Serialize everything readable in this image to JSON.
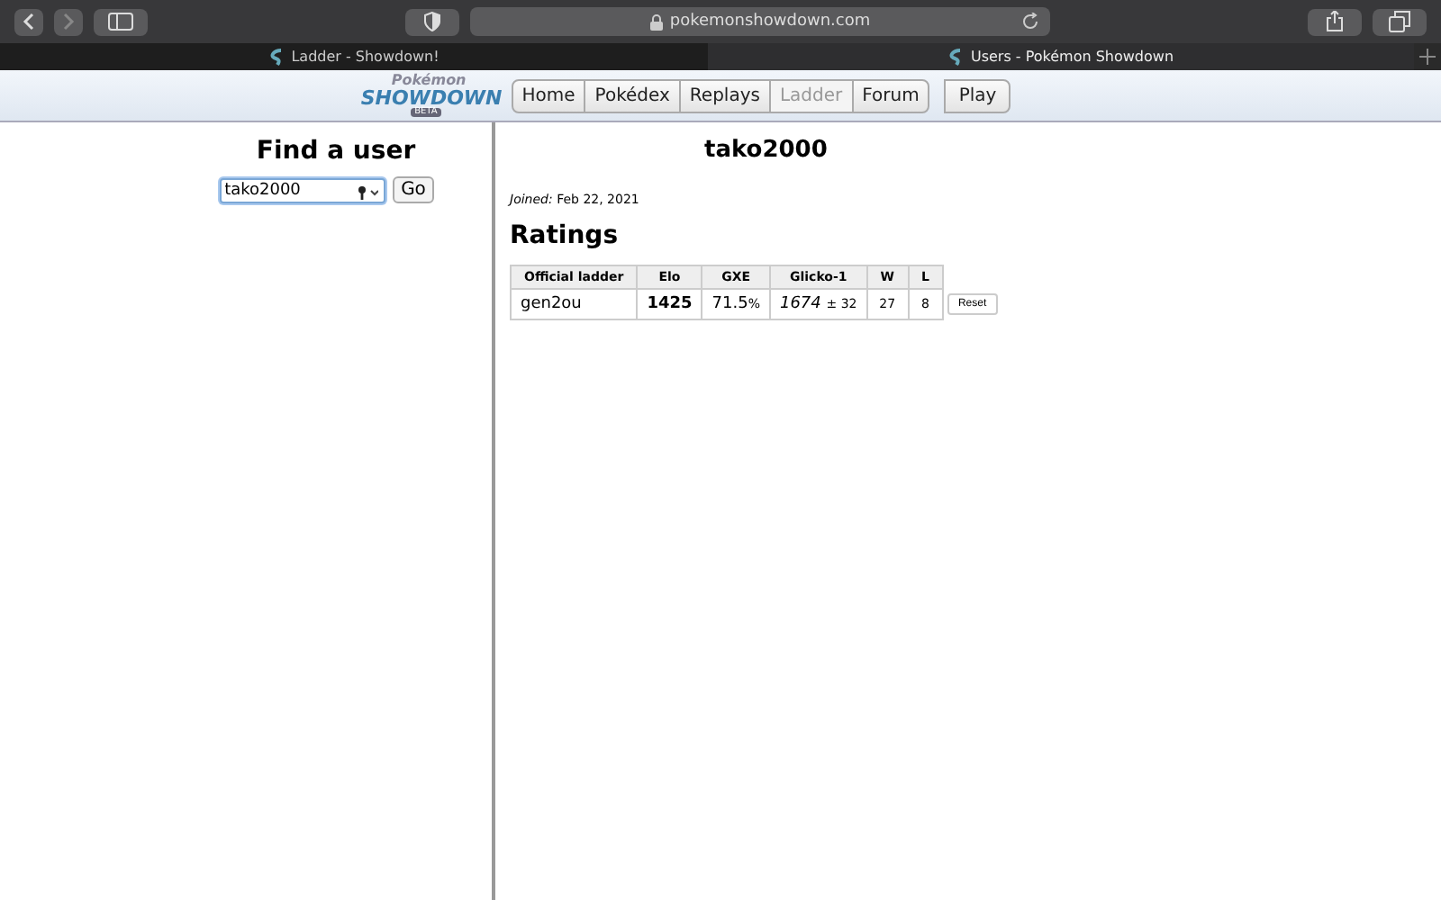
{
  "browser": {
    "url": "pokemonshowdown.com",
    "tabs": [
      {
        "title": "Ladder - Showdown!",
        "selected": false
      },
      {
        "title": "Users - Pokémon Showdown",
        "selected": true
      }
    ]
  },
  "logo": {
    "top": "Pokémon",
    "main": "SHOWDOWN",
    "badge": "BETA"
  },
  "nav": [
    {
      "label": "Home",
      "selected": false
    },
    {
      "label": "Pokédex",
      "selected": false
    },
    {
      "label": "Replays",
      "selected": false
    },
    {
      "label": "Ladder",
      "selected": true
    },
    {
      "label": "Forum",
      "selected": false
    }
  ],
  "play_button": "Play",
  "find_user": {
    "title": "Find a user",
    "value": "tako2000",
    "button": "Go"
  },
  "profile": {
    "name": "tako2000",
    "joined_label": "Joined:",
    "joined": "Feb 22, 2021",
    "ratings_title": "Ratings"
  },
  "table": {
    "columns": [
      "Official ladder",
      "Elo",
      "GXE",
      "Glicko-1",
      "W",
      "L"
    ],
    "rows": [
      {
        "ladder": "gen2ou",
        "elo": "1425",
        "gxe": "71.5",
        "gxe_unit": "%",
        "glicko": "1674",
        "glicko_dev": "± 32",
        "w": "27",
        "l": "8",
        "button": "Reset"
      }
    ]
  }
}
